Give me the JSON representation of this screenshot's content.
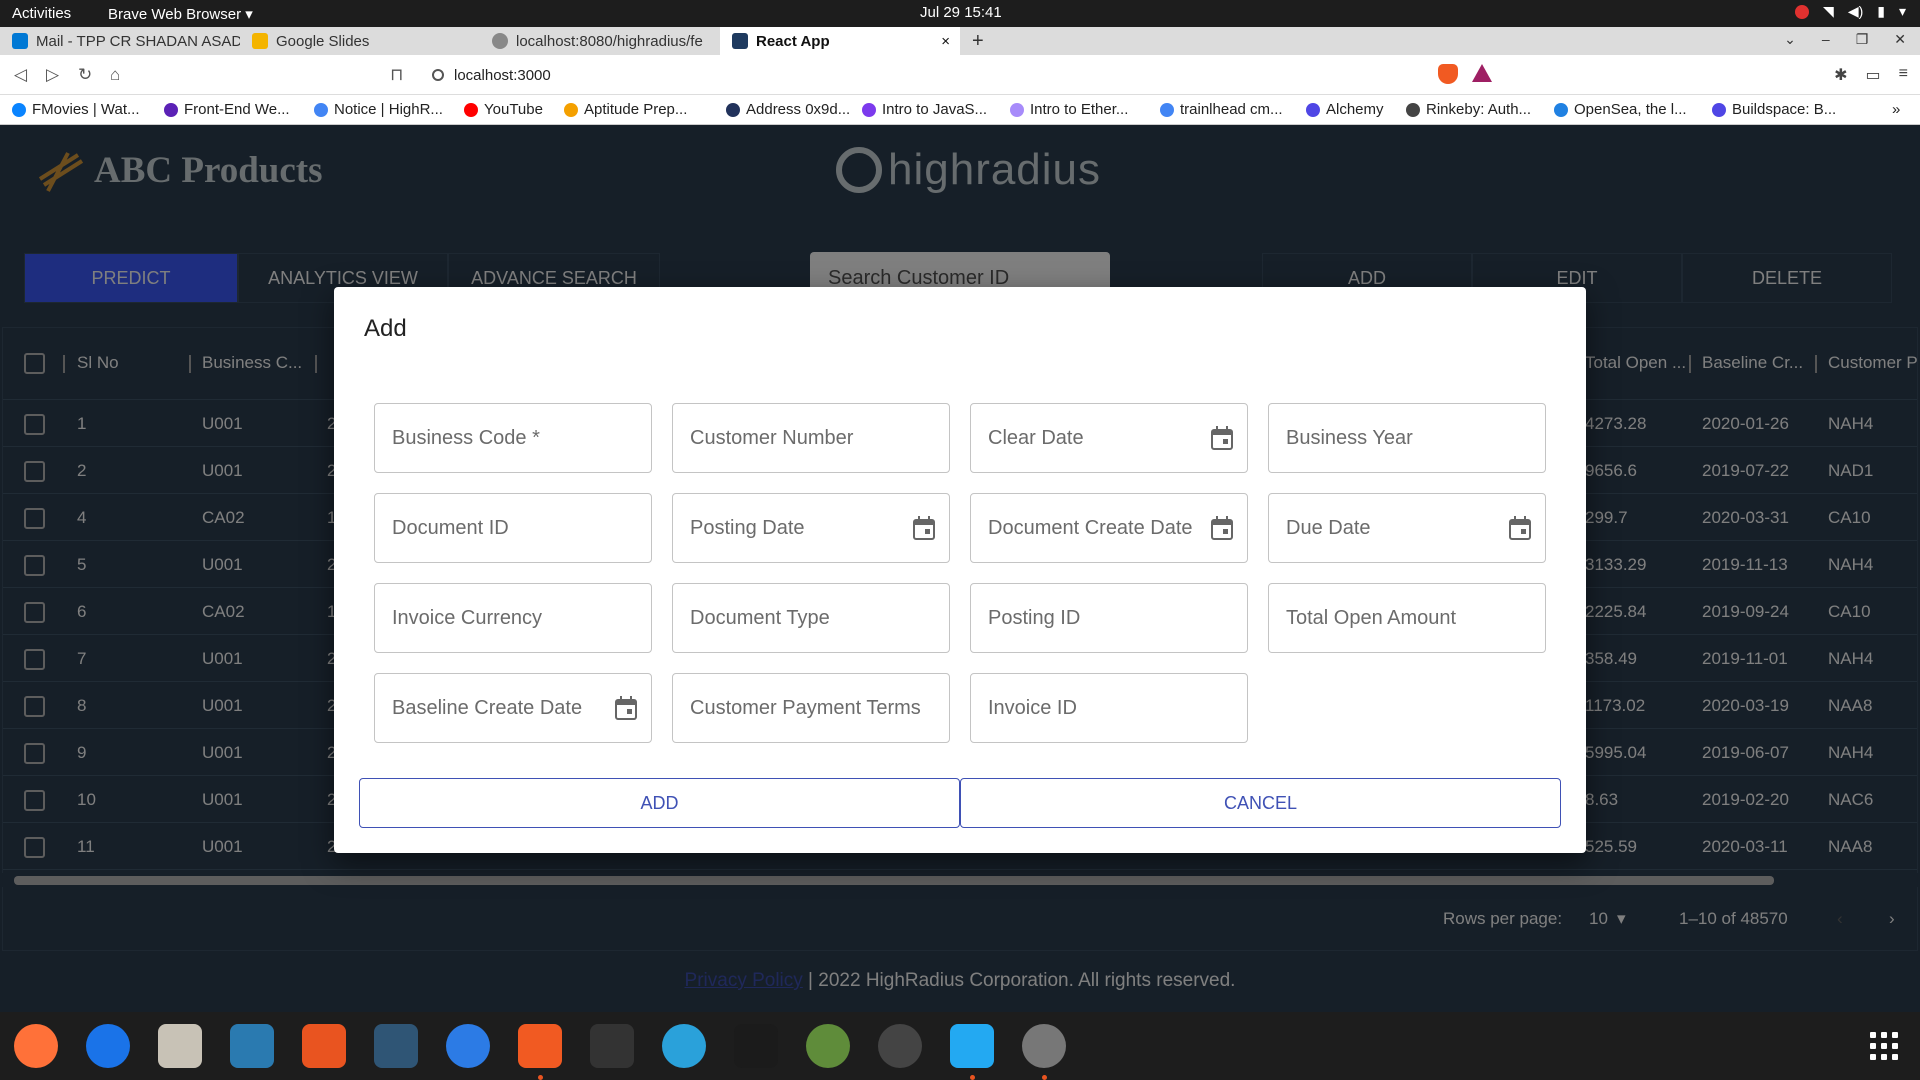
{
  "os": {
    "activities": "Activities",
    "app_menu": "Brave Web Browser ▾",
    "clock": "Jul 29  15:41"
  },
  "browser": {
    "tabs": [
      {
        "label": "Mail - TPP CR SHADAN ASAD -",
        "color": "#0078d4"
      },
      {
        "label": "Google Slides",
        "color": "#f4b400"
      },
      {
        "label": "localhost:8080/highradius/fe",
        "color": "#888888"
      },
      {
        "label": "React App",
        "color": "#1e3a5f",
        "close": "×"
      }
    ],
    "url": "localhost:3000",
    "bookmarks": [
      {
        "label": "FMovies | Wat...",
        "color": "#0a84ff"
      },
      {
        "label": "Front-End We...",
        "color": "#5b21b6"
      },
      {
        "label": "Notice | HighR...",
        "color": "#4285f4"
      },
      {
        "label": "YouTube",
        "color": "#ff0000"
      },
      {
        "label": "Aptitude Prep...",
        "color": "#f4a000"
      },
      {
        "label": "Address 0x9d...",
        "color": "#21325b"
      },
      {
        "label": "Intro to JavaS...",
        "color": "#7c3aed"
      },
      {
        "label": "Intro to Ether...",
        "color": "#a78bfa"
      },
      {
        "label": "trainlhead cm...",
        "color": "#4285f4"
      },
      {
        "label": "Alchemy",
        "color": "#4f46e5"
      },
      {
        "label": "Rinkeby: Auth...",
        "color": "#444444"
      },
      {
        "label": "OpenSea, the l...",
        "color": "#2081e2"
      },
      {
        "label": "Buildspace: B...",
        "color": "#4f46e5"
      }
    ]
  },
  "app": {
    "brand": "ABC Products",
    "partner_logo": "highradius",
    "nav_tabs": [
      "PREDICT",
      "ANALYTICS VIEW",
      "ADVANCE SEARCH"
    ],
    "search_placeholder": "Search Customer ID",
    "action_buttons": [
      "ADD",
      "EDIT",
      "DELETE"
    ],
    "grid_headers": {
      "sl_no": "Sl No",
      "business_code": "Business C...",
      "total_open": "Total Open ...",
      "baseline_create": "Baseline Cr...",
      "customer_payment": "Customer P"
    },
    "rows": [
      {
        "sl": "1",
        "code": "U001",
        "c3": "2",
        "amount": "4273.28",
        "date": "2020-01-26",
        "terms": "NAH4"
      },
      {
        "sl": "2",
        "code": "U001",
        "c3": "2",
        "amount": "9656.6",
        "date": "2019-07-22",
        "terms": "NAD1"
      },
      {
        "sl": "4",
        "code": "CA02",
        "c3": "1",
        "amount": "299.7",
        "date": "2020-03-31",
        "terms": "CA10"
      },
      {
        "sl": "5",
        "code": "U001",
        "c3": "2",
        "amount": "3133.29",
        "date": "2019-11-13",
        "terms": "NAH4"
      },
      {
        "sl": "6",
        "code": "CA02",
        "c3": "1",
        "amount": "2225.84",
        "date": "2019-09-24",
        "terms": "CA10"
      },
      {
        "sl": "7",
        "code": "U001",
        "c3": "2",
        "amount": "358.49",
        "date": "2019-11-01",
        "terms": "NAH4"
      },
      {
        "sl": "8",
        "code": "U001",
        "c3": "2",
        "amount": "1173.02",
        "date": "2020-03-19",
        "terms": "NAA8"
      },
      {
        "sl": "9",
        "code": "U001",
        "c3": "2",
        "amount": "5995.04",
        "date": "2019-06-07",
        "terms": "NAH4"
      },
      {
        "sl": "10",
        "code": "U001",
        "c3": "2",
        "amount": "8.63",
        "date": "2019-02-20",
        "terms": "NAC6"
      },
      {
        "sl": "11",
        "code": "U001",
        "c3": "2",
        "amount": "525.59",
        "date": "2020-03-11",
        "terms": "NAA8"
      }
    ],
    "pagination": {
      "rows_per_page_label": "Rows per page:",
      "rows_per_page_value": "10",
      "range": "1–10 of 48570"
    },
    "footer": {
      "link": "Privacy Policy",
      "text": " | 2022 HighRadius Corporation. All rights reserved."
    }
  },
  "dialog": {
    "title": "Add",
    "fields": [
      {
        "label": "Business Code *",
        "date": false
      },
      {
        "label": "Customer Number",
        "date": false
      },
      {
        "label": "Clear Date",
        "date": true
      },
      {
        "label": "Business Year",
        "date": false
      },
      {
        "label": "Document ID",
        "date": false
      },
      {
        "label": "Posting Date",
        "date": true
      },
      {
        "label": "Document Create Date",
        "date": true
      },
      {
        "label": "Due Date",
        "date": true
      },
      {
        "label": "Invoice Currency",
        "date": false
      },
      {
        "label": "Document Type",
        "date": false
      },
      {
        "label": "Posting ID",
        "date": false
      },
      {
        "label": "Total Open Amount",
        "date": false
      },
      {
        "label": "Baseline Create Date",
        "date": true
      },
      {
        "label": "Customer Payment Terms",
        "date": false
      },
      {
        "label": "Invoice ID",
        "date": false
      }
    ],
    "add_label": "ADD",
    "cancel_label": "CANCEL"
  },
  "dock": {
    "apps": [
      {
        "name": "firefox-icon",
        "color": "#ff7139",
        "round": true,
        "running": false
      },
      {
        "name": "thunderbird-icon",
        "color": "#1a73e8",
        "round": true,
        "running": false
      },
      {
        "name": "files-icon",
        "color": "#c8c2b6",
        "round": false,
        "running": false
      },
      {
        "name": "writer-icon",
        "color": "#2a7ab0",
        "round": false,
        "running": false
      },
      {
        "name": "app-center-icon",
        "color": "#e95420",
        "round": false,
        "running": false
      },
      {
        "name": "mysql-workbench-icon",
        "color": "#2f5575",
        "round": false,
        "running": false
      },
      {
        "name": "help-icon",
        "color": "#2c7be5",
        "round": true,
        "running": false
      },
      {
        "name": "brave-icon",
        "color": "#f15a22",
        "round": false,
        "running": true
      },
      {
        "name": "terminal-icon",
        "color": "#333333",
        "round": false,
        "running": false
      },
      {
        "name": "telegram-icon",
        "color": "#2aa1da",
        "round": true,
        "running": false
      },
      {
        "name": "intellij-icon",
        "color": "#1b1b1b",
        "round": false,
        "running": false
      },
      {
        "name": "globe-tool-icon",
        "color": "#5f8c3a",
        "round": true,
        "running": false
      },
      {
        "name": "wireshark-icon",
        "color": "#444444",
        "round": true,
        "running": false
      },
      {
        "name": "vscode-icon",
        "color": "#23a9f2",
        "round": false,
        "running": true
      },
      {
        "name": "java-ee-ide-icon",
        "color": "#777777",
        "round": true,
        "running": true
      }
    ]
  }
}
